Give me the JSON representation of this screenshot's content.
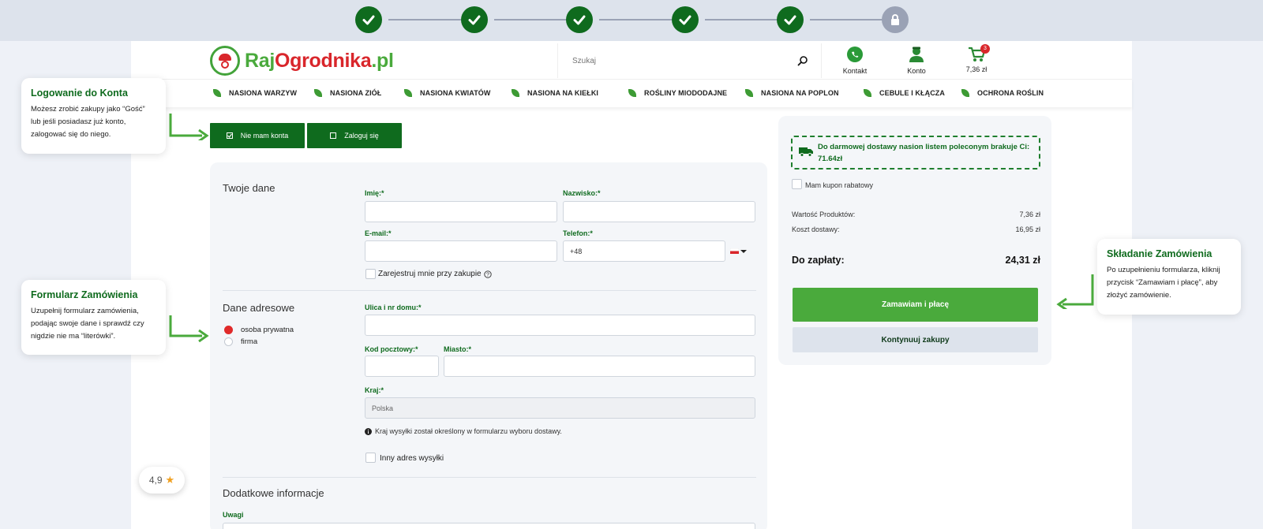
{
  "progress": {
    "steps": [
      "done",
      "done",
      "done",
      "done",
      "done",
      "locked"
    ]
  },
  "header": {
    "logo": {
      "part1": "Raj",
      "part2": "Ogrodnika",
      "part3": ".pl"
    },
    "search_placeholder": "Szukaj",
    "contact_label": "Kontakt",
    "account_label": "Konto",
    "cart_total": "7,36 zł",
    "cart_count": "3"
  },
  "nav": {
    "items": [
      "NASIONA WARZYW",
      "NASIONA ZIÓŁ",
      "NASIONA KWIATÓW",
      "NASIONA NA KIEŁKI",
      "ROŚLINY MIODODAJNE",
      "NASIONA NA POPLON",
      "CEBULE I KŁĄCZA",
      "OCHRONA ROŚLIN"
    ]
  },
  "tips": {
    "login": {
      "title": "Logowanie do Konta",
      "body": "Możesz zrobić zakupy jako “Gość” lub jeśli posiadasz już konto, zalogować się do niego."
    },
    "form": {
      "title": "Formularz Zamówienia",
      "body": "Uzupełnij formularz zamówienia, podając swoje dane i sprawdź czy nigdzie nie ma “literówki”."
    },
    "order": {
      "title": "Składanie Zamówienia",
      "body": "Po uzupełnieniu formularza, kliknij przycisk “Zamawiam i płacę”, aby złożyć zamówienie."
    }
  },
  "login_tabs": {
    "no_account": "Nie mam konta",
    "login": "Zaloguj się"
  },
  "form": {
    "your_data_title": "Twoje dane",
    "first_name_label": "Imię:*",
    "last_name_label": "Nazwisko:*",
    "email_label": "E-mail:*",
    "phone_label": "Telefon:*",
    "phone_prefix": "+48",
    "register_label": "Zarejestruj mnie przy zakupie",
    "address_title": "Dane adresowe",
    "private_person": "osoba prywatna",
    "company": "firma",
    "street_label": "Ulica i nr domu:*",
    "postcode_label": "Kod pocztowy:*",
    "city_label": "Miasto:*",
    "country_label": "Kraj:*",
    "country_value": "Polska",
    "country_note": "Kraj wysyłki został określony w formularzu wyboru dostawy.",
    "other_address_label": "Inny adres wysyłki",
    "extra_title": "Dodatkowe informacje",
    "notes_label": "Uwagi"
  },
  "summary": {
    "free_shipping_text": "Do darmowej dostawy nasion listem poleconym brakuje Ci: 71.64zł",
    "coupon_label": "Mam kupon rabatowy",
    "products_label": "Wartość Produktów:",
    "products_value": "7,36 zł",
    "shipping_label": "Koszt dostawy:",
    "shipping_value": "16,95 zł",
    "total_label": "Do zapłaty:",
    "total_value": "24,31 zł",
    "order_button": "Zamawiam i płacę",
    "continue_button": "Kontynuuj zakupy"
  },
  "rating": {
    "value": "4,9"
  },
  "colors": {
    "brand_dark_green": "#0f6b1e",
    "brand_green": "#4aaa3c",
    "brand_red": "#d9262b",
    "progress_bg": "#dde3ec"
  }
}
